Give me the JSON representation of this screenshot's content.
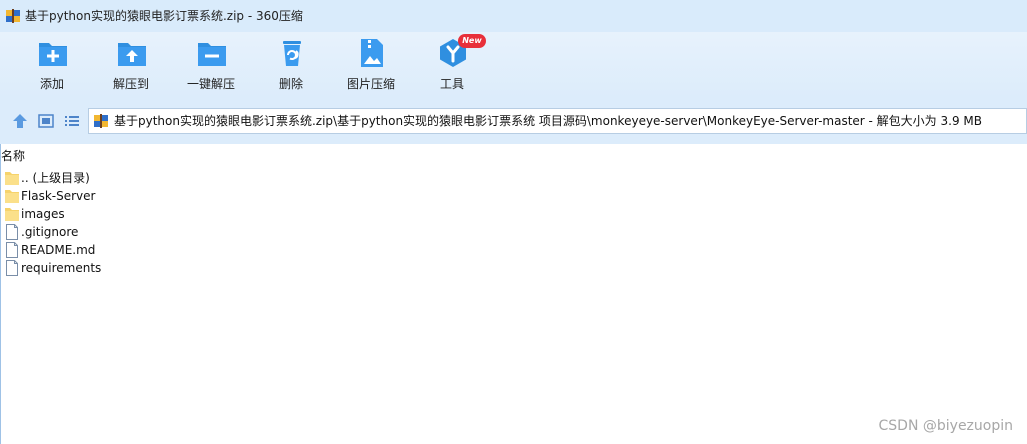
{
  "window": {
    "title": "基于python实现的猿眼电影订票系统.zip - 360压缩"
  },
  "toolbar": {
    "buttons": [
      {
        "label": "添加",
        "icon": "add-icon"
      },
      {
        "label": "解压到",
        "icon": "extract-to-icon"
      },
      {
        "label": "一键解压",
        "icon": "one-click-extract-icon"
      },
      {
        "label": "删除",
        "icon": "delete-icon"
      },
      {
        "label": "图片压缩",
        "icon": "image-compress-icon"
      },
      {
        "label": "工具",
        "icon": "tools-icon",
        "badge": "New"
      }
    ]
  },
  "navbar": {
    "path": "基于python实现的猿眼电影订票系统.zip\\基于python实现的猿眼电影订票系统 项目源码\\monkeyeye-server\\MonkeyEye-Server-master - 解包大小为 3.9 MB"
  },
  "file_list": {
    "column_header": "名称",
    "items": [
      {
        "name": ".. (上级目录)",
        "type": "folder"
      },
      {
        "name": "Flask-Server",
        "type": "folder"
      },
      {
        "name": "images",
        "type": "folder"
      },
      {
        "name": ".gitignore",
        "type": "file"
      },
      {
        "name": "README.md",
        "type": "file"
      },
      {
        "name": "requirements",
        "type": "file"
      }
    ]
  },
  "watermark": "CSDN @biyezuopin",
  "colors": {
    "accent": "#2f8fe0",
    "toolbar_bg": "#dcecfb",
    "badge": "#e8303a"
  }
}
